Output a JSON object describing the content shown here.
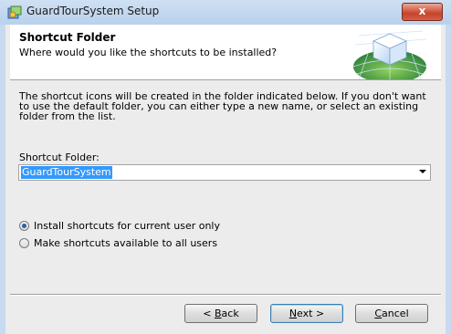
{
  "window": {
    "title": "GuardTourSystem Setup",
    "close_label": "x"
  },
  "header": {
    "title": "Shortcut Folder",
    "subtitle": "Where would you like the shortcuts to be installed?"
  },
  "body": {
    "description_lines": [
      "The shortcut icons will be created in the folder indicated below. If you don't want",
      "to use the default folder, you can either type a new name, or select an existing",
      "folder from the list."
    ],
    "shortcut_folder_label": "Shortcut Folder:",
    "shortcut_folder_value": "GuardTourSystem"
  },
  "options": {
    "items": [
      {
        "label": "Install shortcuts for current user only",
        "selected": true
      },
      {
        "label": "Make shortcuts available to all users",
        "selected": false
      }
    ]
  },
  "buttons": {
    "back": {
      "prefix": "< ",
      "mnemonic": "B",
      "rest": "ack"
    },
    "next": {
      "mnemonic": "N",
      "rest": "ext >"
    },
    "cancel": {
      "mnemonic": "C",
      "rest": "ancel"
    }
  },
  "colors": {
    "selection": "#3399ff",
    "radio_selected": "#2a5fa5"
  }
}
